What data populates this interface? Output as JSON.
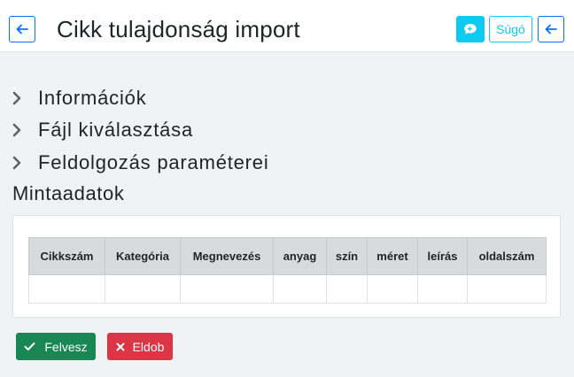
{
  "header": {
    "title": "Cikk tulajdonság import",
    "help_label": "Súgó",
    "icons": {
      "back_left": "arrow-left-icon",
      "chat": "chat-icon",
      "back_right": "arrow-left-icon"
    },
    "colors": {
      "primary": "#0d6efd",
      "info": "#0dcaf0"
    }
  },
  "sections": [
    {
      "label": "Információk",
      "icon": "chevron-right-icon"
    },
    {
      "label": "Fájl kiválasztása",
      "icon": "chevron-right-icon"
    },
    {
      "label": "Feldolgozás paraméterei",
      "icon": "chevron-right-icon"
    }
  ],
  "sample": {
    "title": "Mintaadatok",
    "columns": [
      "Cikkszám",
      "Kategória",
      "Megnevezés",
      "anyag",
      "szín",
      "méret",
      "leírás",
      "oldalszám"
    ],
    "rows": [
      [
        "",
        "",
        "",
        "",
        "",
        "",
        "",
        ""
      ]
    ]
  },
  "actions": {
    "save_label": "Felvesz",
    "discard_label": "Eldob",
    "save_icon": "check-icon",
    "discard_icon": "x-icon",
    "colors": {
      "success": "#198754",
      "danger": "#dc3545"
    }
  }
}
